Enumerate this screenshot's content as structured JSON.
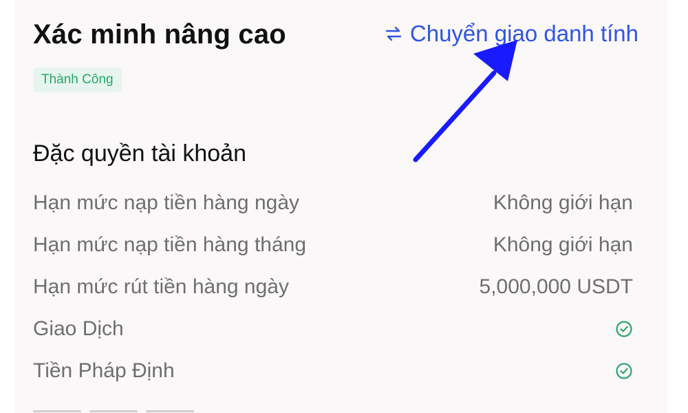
{
  "header": {
    "title": "Xác minh nâng cao",
    "transfer_link": "Chuyển giao danh tính",
    "transfer_icon": "swap-arrows-icon"
  },
  "status_badge": "Thành Công",
  "privileges": {
    "title": "Đặc quyền tài khoản",
    "rows": [
      {
        "label": "Hạn mức nạp tiền hàng ngày",
        "value": "Không giới hạn"
      },
      {
        "label": "Hạn mức nạp tiền hàng tháng",
        "value": "Không giới hạn"
      },
      {
        "label": "Hạn mức rút tiền hàng ngày",
        "value": "5,000,000 USDT"
      },
      {
        "label": "Giao Dịch",
        "value_icon": "check-circle-icon"
      },
      {
        "label": "Tiền Pháp Định",
        "value_icon": "check-circle-icon"
      }
    ]
  },
  "colors": {
    "accent": "#2f55e0",
    "success": "#2aa56a",
    "badge_bg": "#e6f6ee",
    "annotation_arrow": "#1a1aff"
  }
}
